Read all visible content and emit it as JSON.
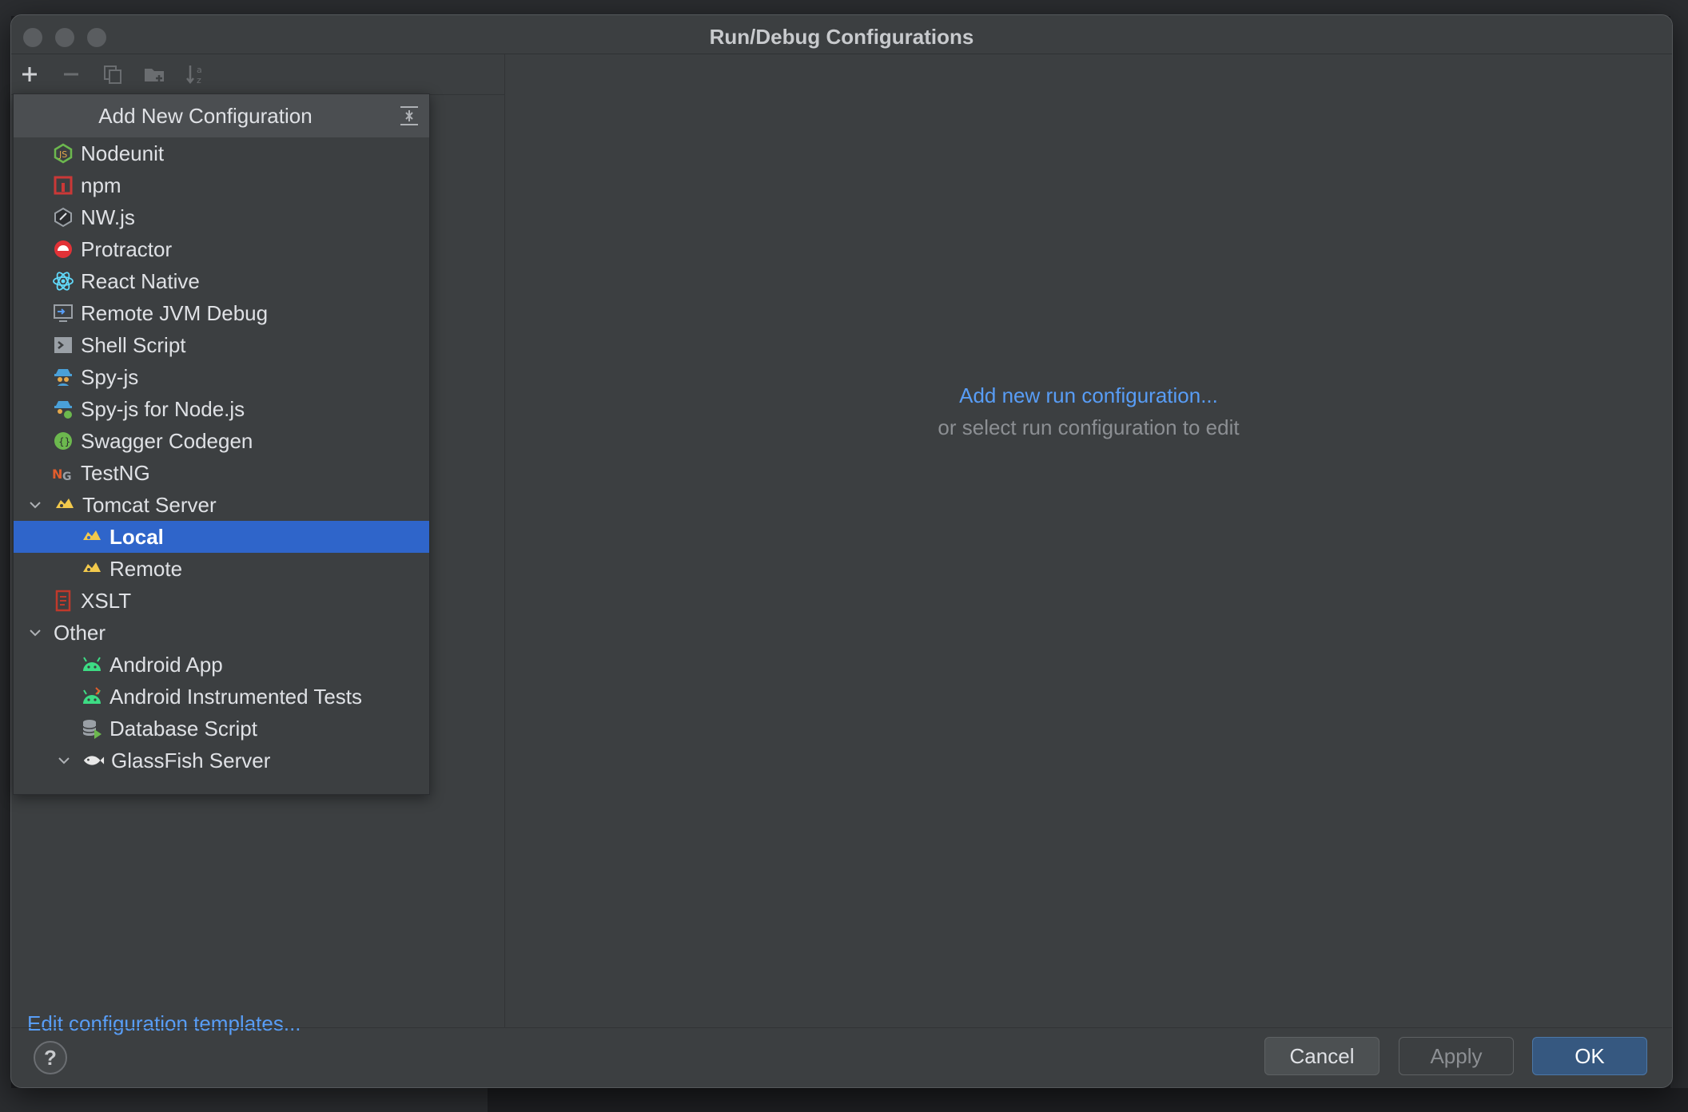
{
  "dialog": {
    "title": "Run/Debug Configurations"
  },
  "popup": {
    "title": "Add New Configuration",
    "items": [
      {
        "label": "Nodeunit",
        "icon": "nodeunit-icon"
      },
      {
        "label": "npm",
        "icon": "npm-icon"
      },
      {
        "label": "NW.js",
        "icon": "nwjs-icon"
      },
      {
        "label": "Protractor",
        "icon": "protractor-icon"
      },
      {
        "label": "React Native",
        "icon": "react-icon"
      },
      {
        "label": "Remote JVM Debug",
        "icon": "remote-debug-icon"
      },
      {
        "label": "Shell Script",
        "icon": "shell-script-icon"
      },
      {
        "label": "Spy-js",
        "icon": "spyjs-icon"
      },
      {
        "label": "Spy-js for Node.js",
        "icon": "spyjs-node-icon"
      },
      {
        "label": "Swagger Codegen",
        "icon": "swagger-icon"
      },
      {
        "label": "TestNG",
        "icon": "testng-icon"
      },
      {
        "label": "Tomcat Server",
        "icon": "tomcat-icon"
      },
      {
        "label": "Local",
        "icon": "tomcat-icon"
      },
      {
        "label": "Remote",
        "icon": "tomcat-icon"
      },
      {
        "label": "XSLT",
        "icon": "xslt-icon"
      },
      {
        "label": "Other",
        "icon": ""
      },
      {
        "label": "Android App",
        "icon": "android-icon"
      },
      {
        "label": "Android Instrumented Tests",
        "icon": "android-test-icon"
      },
      {
        "label": "Database Script",
        "icon": "database-script-icon"
      },
      {
        "label": "GlassFish Server",
        "icon": "glassfish-icon"
      }
    ]
  },
  "main": {
    "add_link": "Add new run configuration...",
    "hint": "or select run configuration to edit"
  },
  "left": {
    "edit_templates": "Edit configuration templates..."
  },
  "footer": {
    "help": "?",
    "cancel": "Cancel",
    "apply": "Apply",
    "ok": "OK"
  }
}
